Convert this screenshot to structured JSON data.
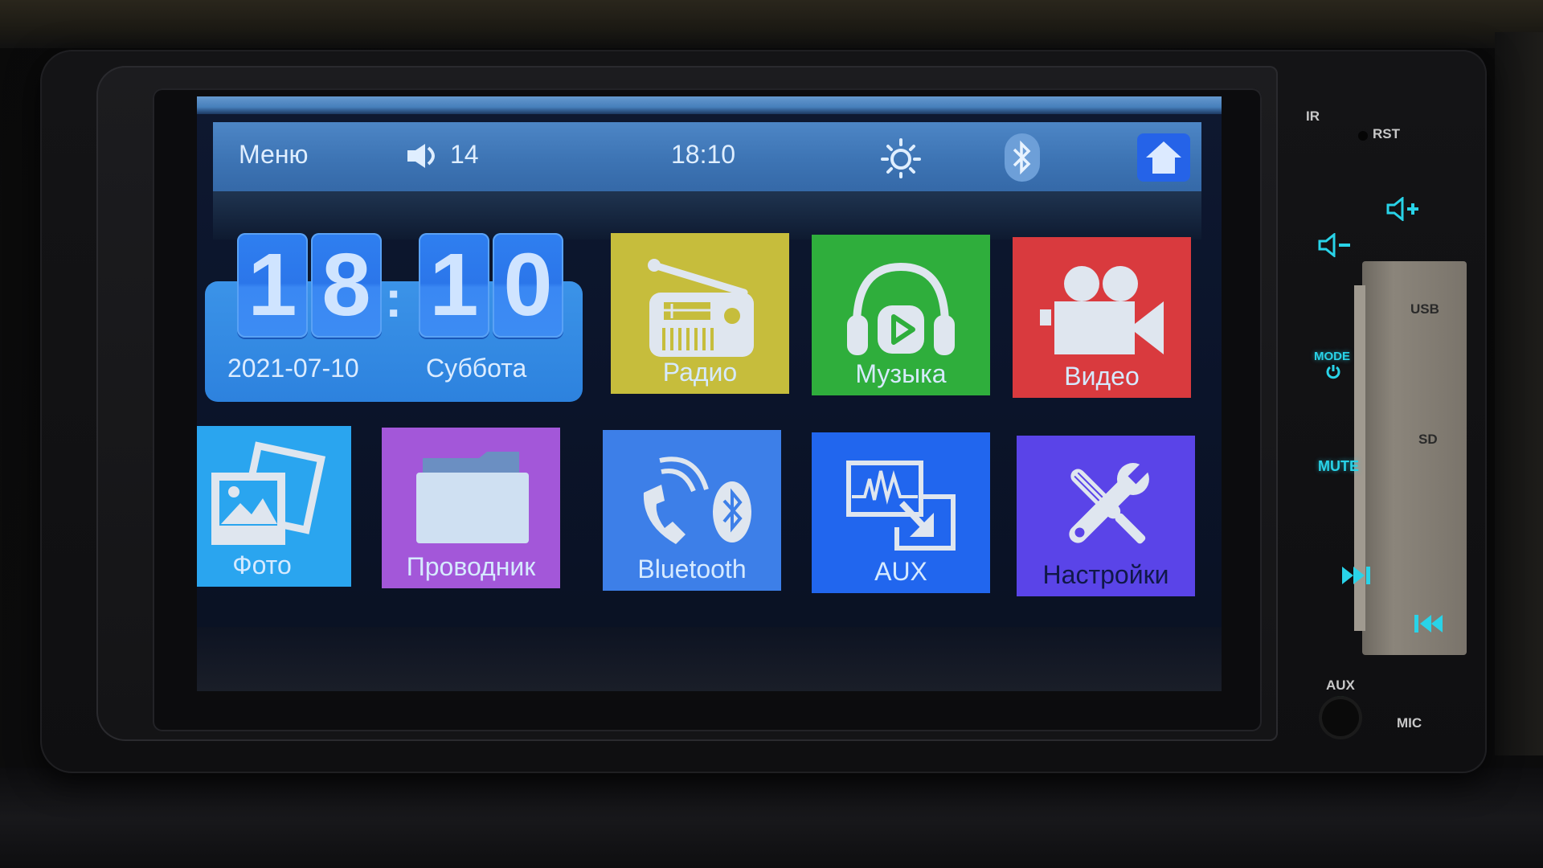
{
  "top_bar": {
    "menu_label": "Меню",
    "volume_icon": "speaker-icon",
    "volume_value": "14",
    "time": "18:10",
    "brightness_icon": "sun-icon",
    "bluetooth_icon": "bluetooth-icon",
    "home_icon": "home-icon"
  },
  "clock_widget": {
    "hour_tens": "1",
    "hour_ones": "8",
    "separator": ":",
    "minute_tens": "1",
    "minute_ones": "0",
    "date": "2021-07-10",
    "weekday": "Суббота"
  },
  "tiles": [
    {
      "label": "Радио",
      "icon": "radio-icon",
      "color": "#c6bd3c"
    },
    {
      "label": "Музыка",
      "icon": "headphones-icon",
      "color": "#2fae3c"
    },
    {
      "label": "Видео",
      "icon": "video-camera-icon",
      "color": "#d93a3e"
    },
    {
      "label": "Фото",
      "icon": "photos-icon",
      "color": "#2aa5ef"
    },
    {
      "label": "Проводник",
      "icon": "folder-icon",
      "color": "#a357d9"
    },
    {
      "label": "Bluetooth",
      "icon": "phone-bluetooth-icon",
      "color": "#3d7fe8"
    },
    {
      "label": "AUX",
      "icon": "aux-input-icon",
      "color": "#2166ee"
    },
    {
      "label": "Настройки",
      "icon": "tools-icon",
      "color": "#5a44e8"
    }
  ],
  "hardware_panel": {
    "ir_label": "IR",
    "rst_label": "RST",
    "vol_up_icon": "volume-up-icon",
    "vol_down_icon": "volume-down-icon",
    "usb_label": "USB",
    "mode_label": "MODE",
    "power_icon": "power-icon",
    "sd_label": "SD",
    "mute_label": "MUTE",
    "next_icon": "next-track-icon",
    "prev_icon": "previous-track-icon",
    "aux_label": "AUX",
    "mic_label": "MIC",
    "accent_color": "#29d3e8"
  }
}
